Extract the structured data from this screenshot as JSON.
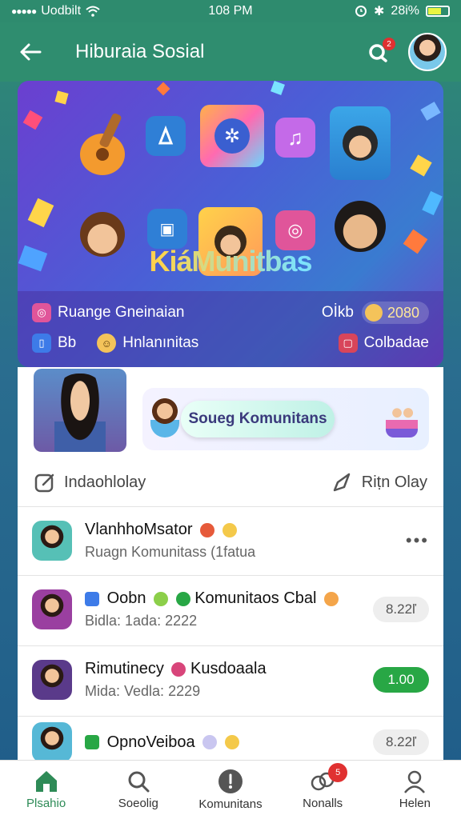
{
  "status_bar": {
    "carrier": "Uodbilt",
    "time": "108 PM",
    "battery_text": "28i%"
  },
  "app_bar": {
    "title": "Hiburaia Sosial",
    "notification_badge": "2"
  },
  "hero": {
    "title": "KiáMunitbas",
    "row1_label": "Ruange Gneinaian",
    "row1_right_text": "Oİkb",
    "row1_count": "2080",
    "row2_left_label": "Bb",
    "row2_mid_label": "Hnlanınitas",
    "row2_right_label": "Colbadae"
  },
  "promo": {
    "pill_text": "Soueg Komunitans"
  },
  "actions": {
    "left_label": "Indaohlolay",
    "right_label": "Riṭn Olay"
  },
  "rows": [
    {
      "title": "VlanhhoMsator",
      "subtitle": "Ruagn Komunitass (1fatua",
      "trailing": "•••",
      "avatar_color": "#56c0b6"
    },
    {
      "title": "Oobn",
      "title_suffix": "Komunitaos Cbal",
      "subtitle": "Bidla: 1ada: 2222",
      "chip": "8.22ľ",
      "avatar_color": "#9a3fa0"
    },
    {
      "title": "Rimutinecy",
      "title_suffix": "Kusdoaala",
      "subtitle": "Mida: Vedla: 2229",
      "chip": "1.00",
      "chip_green": true,
      "avatar_color": "#5a3a8a"
    },
    {
      "title": "OpnoVeiboa",
      "chip": "8.22ľ",
      "avatar_color": "#56b8d6"
    }
  ],
  "bottom_nav": [
    {
      "label": "Plsahio",
      "icon": "home-icon",
      "active": true
    },
    {
      "label": "Soeolig",
      "icon": "search-icon"
    },
    {
      "label": "Komunitans",
      "icon": "community-icon"
    },
    {
      "label": "Nonalls",
      "icon": "notifications-icon",
      "badge": "5"
    },
    {
      "label": "Helen",
      "icon": "profile-icon"
    }
  ],
  "colors": {
    "primary": "#2f8d6f",
    "accent_green": "#28a745",
    "badge_red": "#e03131",
    "hero_purple": "#6b3fd0"
  }
}
